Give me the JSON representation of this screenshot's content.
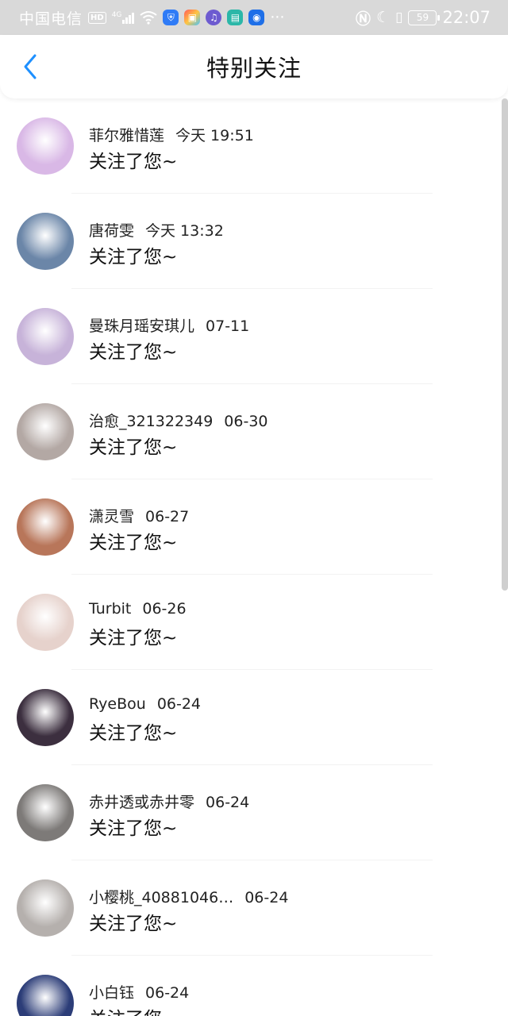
{
  "status_bar": {
    "carrier": "中国电信",
    "hd_badge": "HD",
    "network": "4G",
    "battery": "59",
    "time": "22:07",
    "more": "···"
  },
  "header": {
    "title": "特别关注",
    "back_icon": "chevron-left-icon"
  },
  "follows": [
    {
      "name": "菲尔雅惜莲",
      "time": "今天 19:51",
      "message": "关注了您~",
      "avatar_color": "#d9b8e6"
    },
    {
      "name": "唐荷雯",
      "time": "今天 13:32",
      "message": "关注了您~",
      "avatar_color": "#6b86a8"
    },
    {
      "name": "曼珠月瑶安琪儿",
      "time": "07-11",
      "message": "关注了您~",
      "avatar_color": "#c7b3d9"
    },
    {
      "name": "治愈_321322349",
      "time": "06-30",
      "message": "关注了您~",
      "avatar_color": "#b3a8a4"
    },
    {
      "name": "潇灵雪",
      "time": "06-27",
      "message": "关注了您~",
      "avatar_color": "#b8765a"
    },
    {
      "name": "Turbit",
      "time": "06-26",
      "message": "关注了您~",
      "avatar_color": "#e6d2cc"
    },
    {
      "name": "RyeBou",
      "time": "06-24",
      "message": "关注了您~",
      "avatar_color": "#3c2f3f"
    },
    {
      "name": "赤井透或赤井零",
      "time": "06-24",
      "message": "关注了您~",
      "avatar_color": "#7d7a78"
    },
    {
      "name": "小樱桃_40881046…",
      "time": "06-24",
      "message": "关注了您~",
      "avatar_color": "#b5b0ad"
    },
    {
      "name": "小白钰",
      "time": "06-24",
      "message": "关注了您~",
      "avatar_color": "#2c3d78"
    }
  ],
  "accent_color": "#1e90ff"
}
